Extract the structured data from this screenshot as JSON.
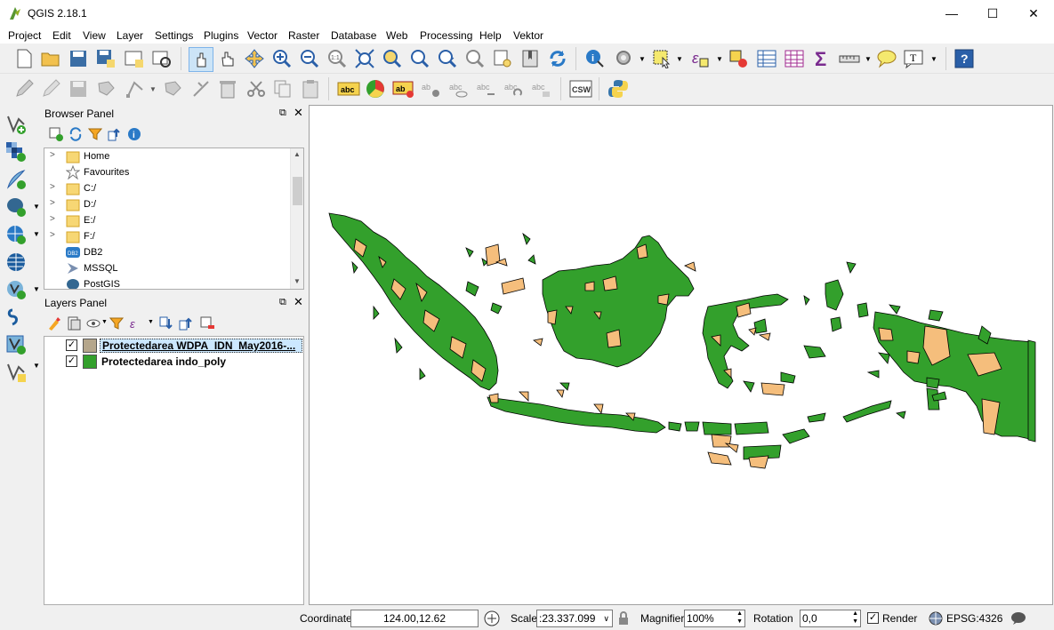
{
  "window": {
    "title": "QGIS 2.18.1",
    "minimize": "—",
    "maximize": "☐",
    "close": "✕"
  },
  "menu": [
    "Project",
    "Edit",
    "View",
    "Layer",
    "Settings",
    "Plugins",
    "Vector",
    "Raster",
    "Database",
    "Web",
    "Processing",
    "Help",
    "Vektor"
  ],
  "browser_panel": {
    "title": "Browser Panel",
    "items": [
      {
        "label": "Home",
        "icon": "folder-icon"
      },
      {
        "label": "Favourites",
        "icon": "star-icon"
      },
      {
        "label": "C:/",
        "icon": "folder-icon"
      },
      {
        "label": "D:/",
        "icon": "folder-icon"
      },
      {
        "label": "E:/",
        "icon": "folder-icon"
      },
      {
        "label": "F:/",
        "icon": "folder-icon"
      },
      {
        "label": "DB2",
        "icon": "db2-icon"
      },
      {
        "label": "MSSQL",
        "icon": "mssql-icon"
      },
      {
        "label": "PostGIS",
        "icon": "postgis-icon"
      }
    ]
  },
  "layers_panel": {
    "title": "Layers Panel",
    "layers": [
      {
        "name": "Protectedarea WDPA_IDN_May2016-...",
        "color": "#b5a68b",
        "checked": true,
        "selected": true
      },
      {
        "name": "Protectedarea indo_poly",
        "color": "#33a02c",
        "checked": true,
        "selected": false
      }
    ]
  },
  "toolbar_icons": {
    "label_abc": "abc",
    "label_csw": "CSW",
    "label_ab": "ab",
    "label_ttl": "T"
  },
  "status": {
    "coordinate_label": "Coordinate",
    "coordinate_value": "124.00,12.62",
    "scale_label": "Scale",
    "scale_value": ":23.337.099",
    "magnifier_label": "Magnifier",
    "magnifier_value": "100%",
    "rotation_label": "Rotation",
    "rotation_value": "0,0",
    "render_label": "Render",
    "render_checked": true,
    "crs": "EPSG:4326"
  },
  "colors": {
    "land": "#33a02c",
    "protected": "#f5be7c",
    "outline": "#000000"
  }
}
